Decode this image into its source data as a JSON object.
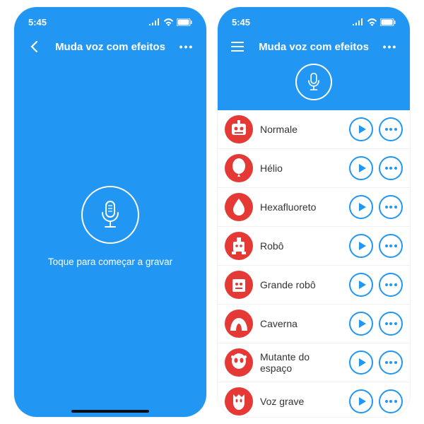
{
  "status": {
    "time": "5:45"
  },
  "header": {
    "title": "Muda voz com efeitos"
  },
  "record": {
    "hint": "Toque para começar a gravar"
  },
  "effects": [
    {
      "label": "Normale",
      "icon": "robot-face"
    },
    {
      "label": "Hélio",
      "icon": "balloon"
    },
    {
      "label": "Hexafluoreto",
      "icon": "drop"
    },
    {
      "label": "Robô",
      "icon": "robot"
    },
    {
      "label": "Grande robô",
      "icon": "robot-big"
    },
    {
      "label": "Caverna",
      "icon": "cave"
    },
    {
      "label": "Mutante do espaço",
      "icon": "alien"
    },
    {
      "label": "Voz grave",
      "icon": "bat"
    }
  ],
  "colors": {
    "primary": "#2196f3",
    "accent": "#e53935"
  }
}
